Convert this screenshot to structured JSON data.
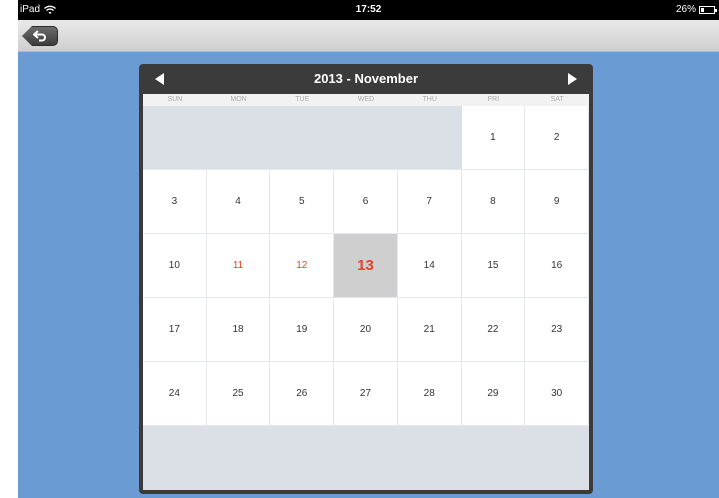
{
  "status_bar": {
    "device": "iPad",
    "time": "17:52",
    "battery_percent": "26%",
    "battery_level": 0.26
  },
  "nav": {
    "back_icon": "back-arrow-icon"
  },
  "calendar": {
    "title": "2013 - November",
    "weekdays": [
      "SUN",
      "MON",
      "TUE",
      "WED",
      "THU",
      "FRI",
      "SAT"
    ],
    "leading_empty_cells": 5,
    "days": [
      "1",
      "2",
      "3",
      "4",
      "5",
      "6",
      "7",
      "8",
      "9",
      "10",
      "11",
      "12",
      "13",
      "14",
      "15",
      "16",
      "17",
      "18",
      "19",
      "20",
      "21",
      "22",
      "23",
      "24",
      "25",
      "26",
      "27",
      "28",
      "29",
      "30"
    ],
    "holidays": [
      "11",
      "12"
    ],
    "today": "13",
    "colors": {
      "holiday": "#e8402a",
      "today_bg": "#cfcfcf",
      "background": "#6b9bd3",
      "header": "#3b3b3b"
    }
  }
}
